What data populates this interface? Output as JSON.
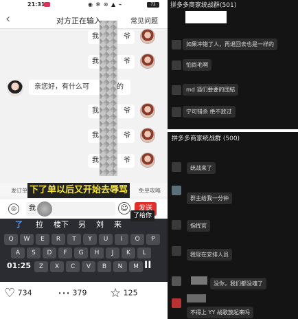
{
  "left": {
    "status_bar": {
      "time": "21:31",
      "icons": "◉ ✻ ⊛ ▲ ⌁",
      "battery": "72"
    },
    "chat_header": {
      "title": "对方正在输入...",
      "faq_label": "常见问题"
    },
    "messages": [
      {
        "text": "我",
        "tail": "爷"
      },
      {
        "text": "我",
        "tail": "爷"
      },
      {
        "text": "我",
        "tail": "爷"
      },
      {
        "text": "我",
        "tail": "爷"
      },
      {
        "text": "我",
        "tail": "爷"
      },
      {
        "text": "我",
        "tail": "爷"
      }
    ],
    "agent_message": {
      "text": "亲您好，有什么可",
      "tail": "的"
    },
    "quick_bar": {
      "left": "发订单",
      "right": "免单攻略"
    },
    "caption": "下了单以后又开始去辱骂",
    "input": {
      "value": "我",
      "send_label": "发送"
    },
    "keyboard": {
      "candidates": [
        "了",
        "拉",
        "楼下",
        "另",
        "刘",
        "来"
      ],
      "tip": "了给你",
      "row1": [
        "Q",
        "W",
        "E",
        "R",
        "T",
        "Y",
        "U",
        "I",
        "O",
        "P"
      ],
      "row2": [
        "A",
        "S",
        "D",
        "F",
        "G",
        "H",
        "J",
        "K",
        "L"
      ],
      "row3": [
        "Z",
        "X",
        "C",
        "V",
        "B",
        "N",
        "M"
      ],
      "timer": "01:25",
      "pause": "II"
    },
    "reactions": {
      "likes": "734",
      "comments": "379",
      "favorites": "125"
    }
  },
  "right_top": {
    "group_title": "拼多多商家统战群(501)",
    "messages": [
      "如果冲错了人，再退回去也是一样的",
      "怕尚毛啊",
      "md 逼们要要的団結",
      "宁可错杀 绝不放过"
    ]
  },
  "right_bottom": {
    "group_title": "拼多多商家统战群 (500)",
    "messages": [
      "统战来了",
      "群主给我一分钟",
      "指挥官",
      "我现在安排人员",
      "没你，我们都没魂了",
      "不得上 YY 战歌放起来吗"
    ]
  }
}
